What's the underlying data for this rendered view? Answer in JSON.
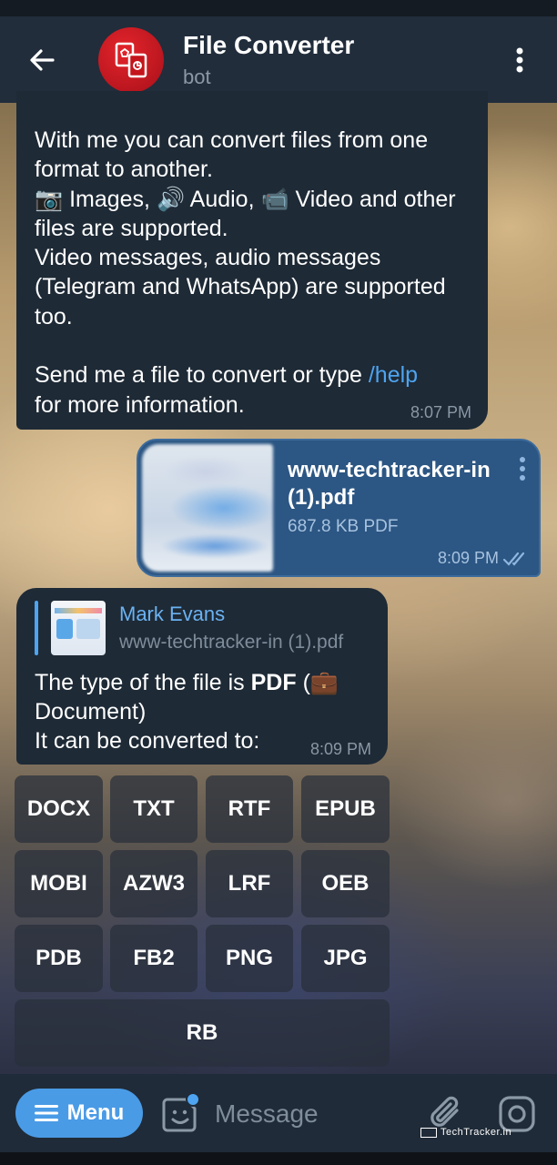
{
  "header": {
    "title": "File Converter",
    "subtitle": "bot"
  },
  "messages": {
    "welcome": {
      "text_lines": "With me you can convert files from one format to another.\n📷 Images, 🔊 Audio, 📹 Video and other files are supported.\nVideo messages, audio messages (Telegram and WhatsApp) are supported too.\n\nSend me a file to convert or type ",
      "link": "/help",
      "text_after": "\nfor more information.",
      "time": "8:07 PM"
    },
    "file": {
      "name": "www-techtracker-in (1).pdf",
      "size": "687.8 KB PDF",
      "time": "8:09 PM"
    },
    "reply": {
      "reply_name": "Mark Evans",
      "reply_file": "www-techtracker-in (1).pdf",
      "text_prefix": "The type of the file is ",
      "text_bold": "PDF",
      "text_suffix": " (💼\nDocument)\nIt can be converted to:",
      "time": "8:09 PM"
    }
  },
  "keyboard": {
    "rows": [
      [
        "DOCX",
        "TXT",
        "RTF",
        "EPUB"
      ],
      [
        "MOBI",
        "AZW3",
        "LRF",
        "OEB"
      ],
      [
        "PDB",
        "FB2",
        "PNG",
        "JPG"
      ],
      [
        "RB"
      ]
    ]
  },
  "input_bar": {
    "menu_label": "Menu",
    "placeholder": "Message",
    "watermark": "TechTracker.in"
  },
  "colors": {
    "header_bg": "#212d3b",
    "incoming_bubble": "#1e2a36",
    "outgoing_bubble": "#2c5683",
    "accent": "#4a9be6",
    "link": "#4ea4f0",
    "avatar": "#d0161e"
  },
  "icons": {
    "back": "back-arrow-icon",
    "more": "kebab-menu-icon",
    "read": "double-check-icon",
    "emoji": "sticker-icon",
    "attach": "paperclip-icon",
    "camera": "instagram-camera-icon"
  }
}
